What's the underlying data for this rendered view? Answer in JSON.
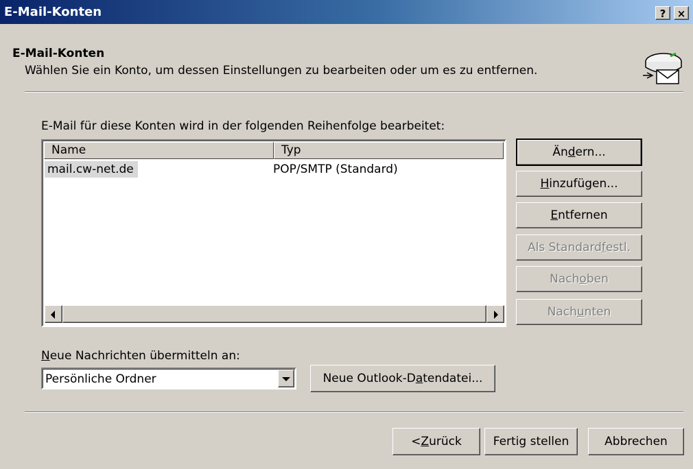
{
  "window": {
    "title": "E-Mail-Konten",
    "help_button": "?",
    "close_button": "×"
  },
  "header": {
    "title": "E-Mail-Konten",
    "subtitle": "Wählen Sie ein Konto, um dessen Einstellungen zu bearbeiten oder um es zu entfernen.",
    "icon": "mail-accounts-icon"
  },
  "accounts": {
    "caption": "E-Mail für diese Konten wird in der folgenden Reihenfolge bearbeitet:",
    "columns": [
      "Name",
      "Typ"
    ],
    "rows": [
      {
        "name": "mail.cw-net.de",
        "type": "POP/SMTP (Standard)"
      }
    ]
  },
  "side_buttons": {
    "change": {
      "pre": "Än",
      "key": "d",
      "post": "ern...",
      "enabled": true
    },
    "add": {
      "pre": "",
      "key": "H",
      "post": "inzufügen...",
      "enabled": true
    },
    "remove": {
      "pre": "",
      "key": "E",
      "post": "ntfernen",
      "enabled": true
    },
    "set_default": {
      "pre": "Als Standard ",
      "key": "f",
      "post": "estl.",
      "enabled": false
    },
    "move_up": {
      "pre": "Nach ",
      "key": "o",
      "post": "ben",
      "enabled": false
    },
    "move_down": {
      "pre": "Nach ",
      "key": "u",
      "post": "nten",
      "enabled": false
    }
  },
  "delivery": {
    "label_key": "N",
    "label_rest": "eue Nachrichten übermitteln an:",
    "selected": "Persönliche Ordner",
    "new_file": {
      "pre": "Neue Outlook-D",
      "key": "a",
      "post": "tendatei..."
    }
  },
  "footer": {
    "back": {
      "pre": "< ",
      "key": "Z",
      "post": "urück"
    },
    "finish": "Fertig stellen",
    "cancel": "Abbrechen"
  }
}
